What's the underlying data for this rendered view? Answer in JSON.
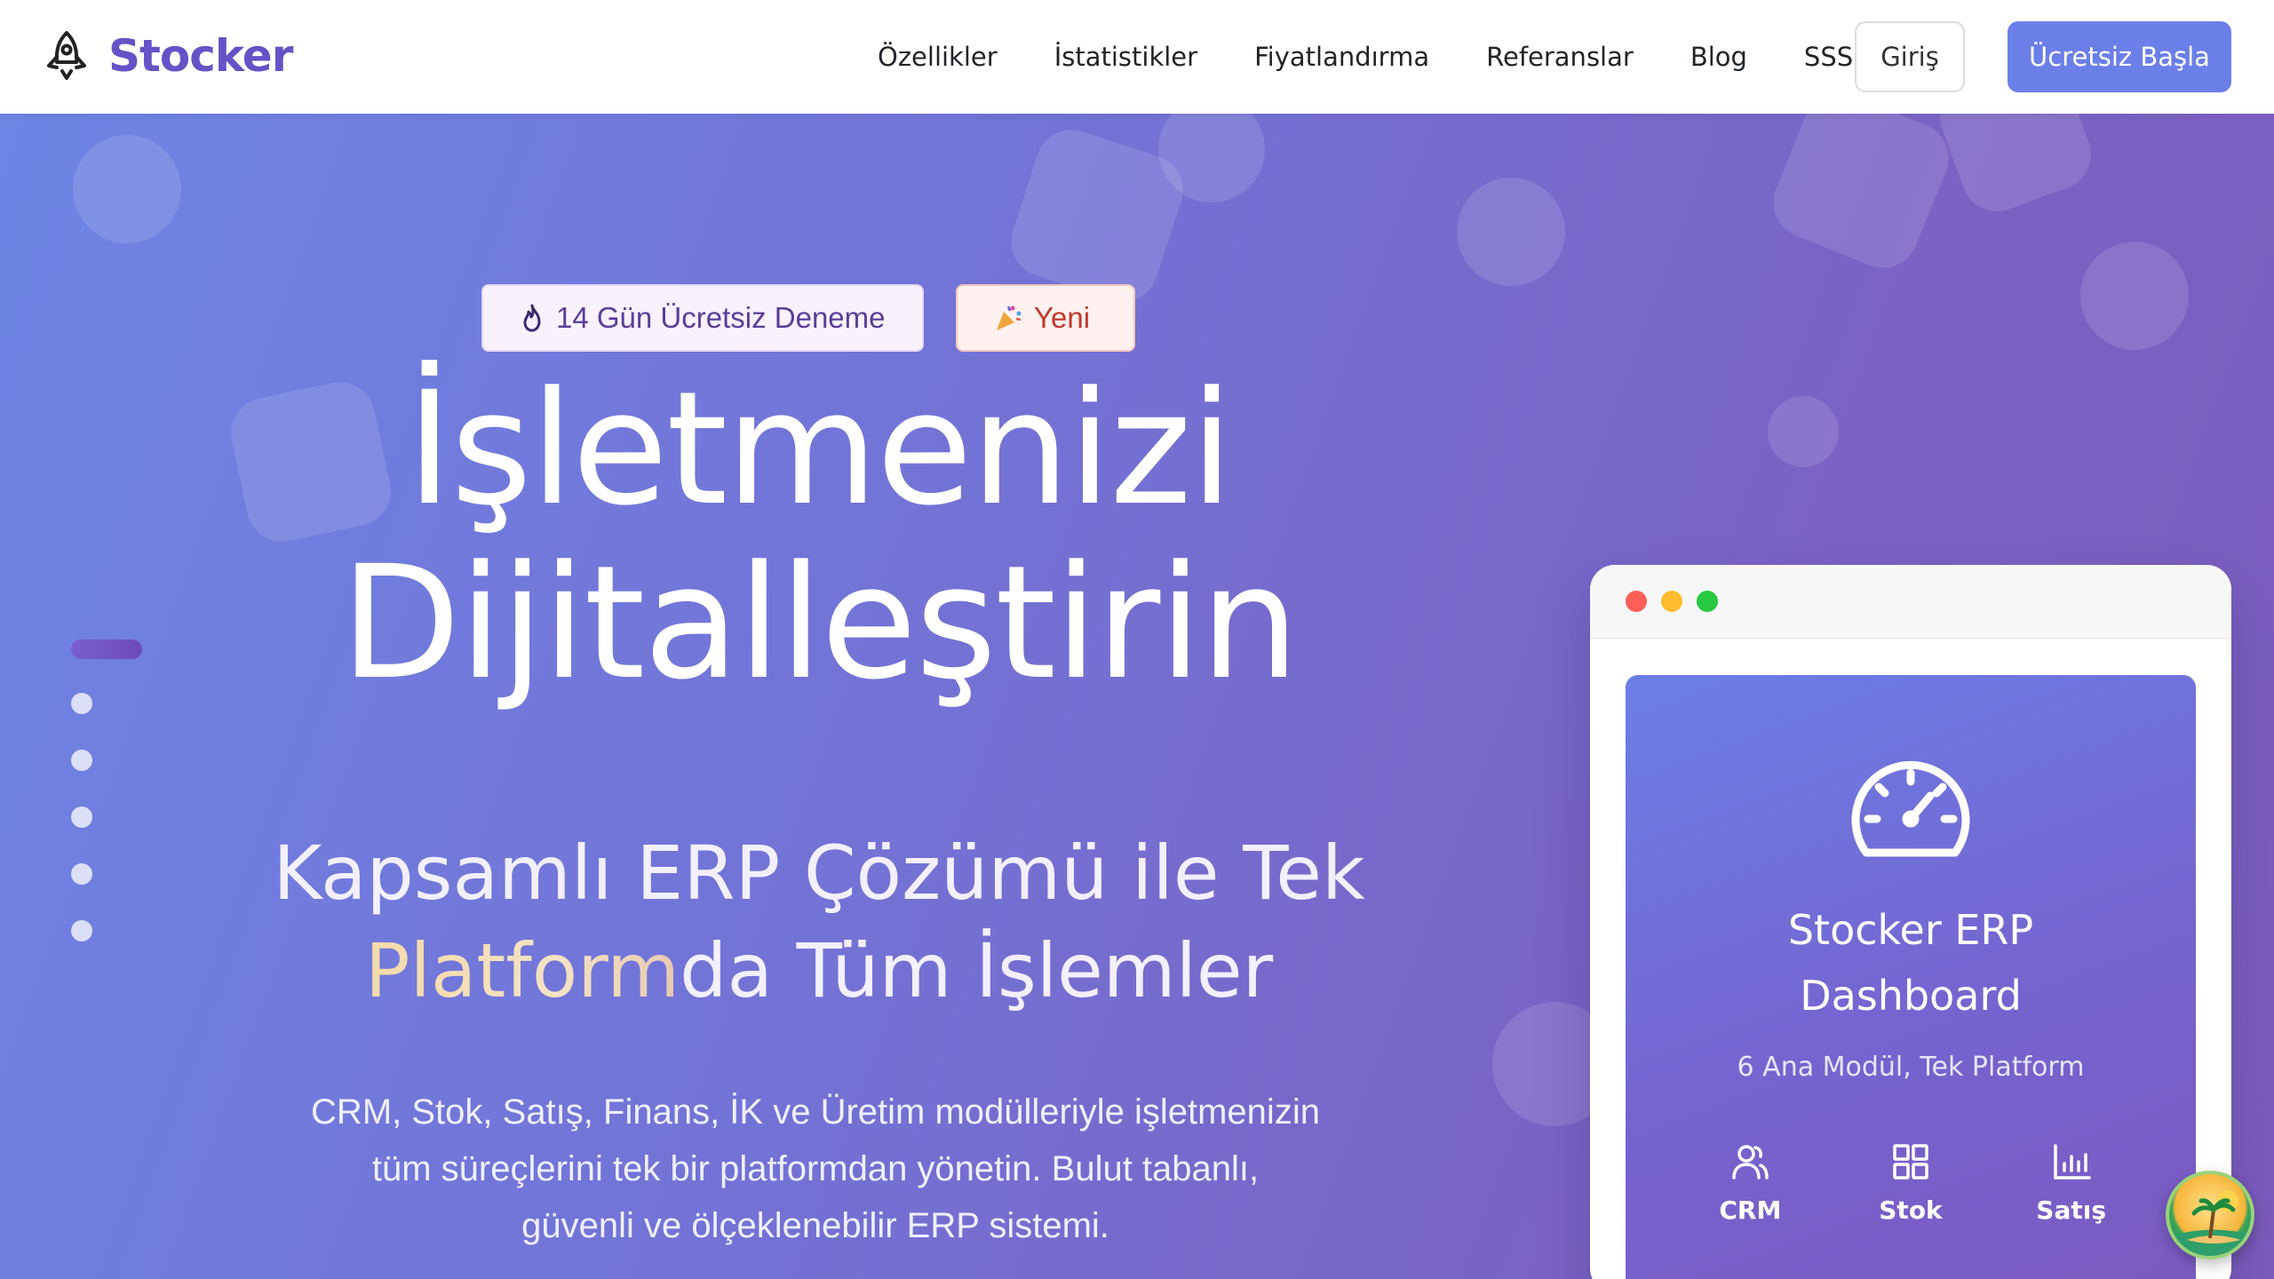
{
  "brand": {
    "name": "Stocker",
    "icon": "rocket-icon"
  },
  "nav": {
    "links": [
      "Özellikler",
      "İstatistikler",
      "Fiyatlandırma",
      "Referanslar",
      "Blog",
      "SSS"
    ],
    "login_label": "Giriş",
    "start_label": "Ücretsiz Başla"
  },
  "hero": {
    "badge_trial": "14 Gün Ücretsiz Deneme",
    "badge_new": "Yeni",
    "title_line1": "İşletmenizi",
    "title_line2": "Dijitalleştirin",
    "subtitle_line1": "Kapsamlı ERP Çözümü ile Tek",
    "subtitle_highlight": "Platform",
    "subtitle_rest": "da Tüm İşlemler",
    "description_line1": "CRM, Stok, Satış, Finans, İK ve Üretim modülleriyle işletmenizin",
    "description_line2": "tüm süreçlerini tek bir platformdan yönetin. Bulut tabanlı,",
    "description_line3": "güvenli ve ölçeklenebilir ERP sistemi."
  },
  "dashboard": {
    "title_line1": "Stocker ERP",
    "title_line2": "Dashboard",
    "subtitle": "6 Ana Modül, Tek Platform",
    "modules": [
      "CRM",
      "Stok",
      "Satış"
    ]
  },
  "colors": {
    "brand": "#6552c6",
    "primary_button": "#6b7fe8",
    "hero_start": "#6e85e4",
    "hero_end": "#7c5cbd"
  }
}
